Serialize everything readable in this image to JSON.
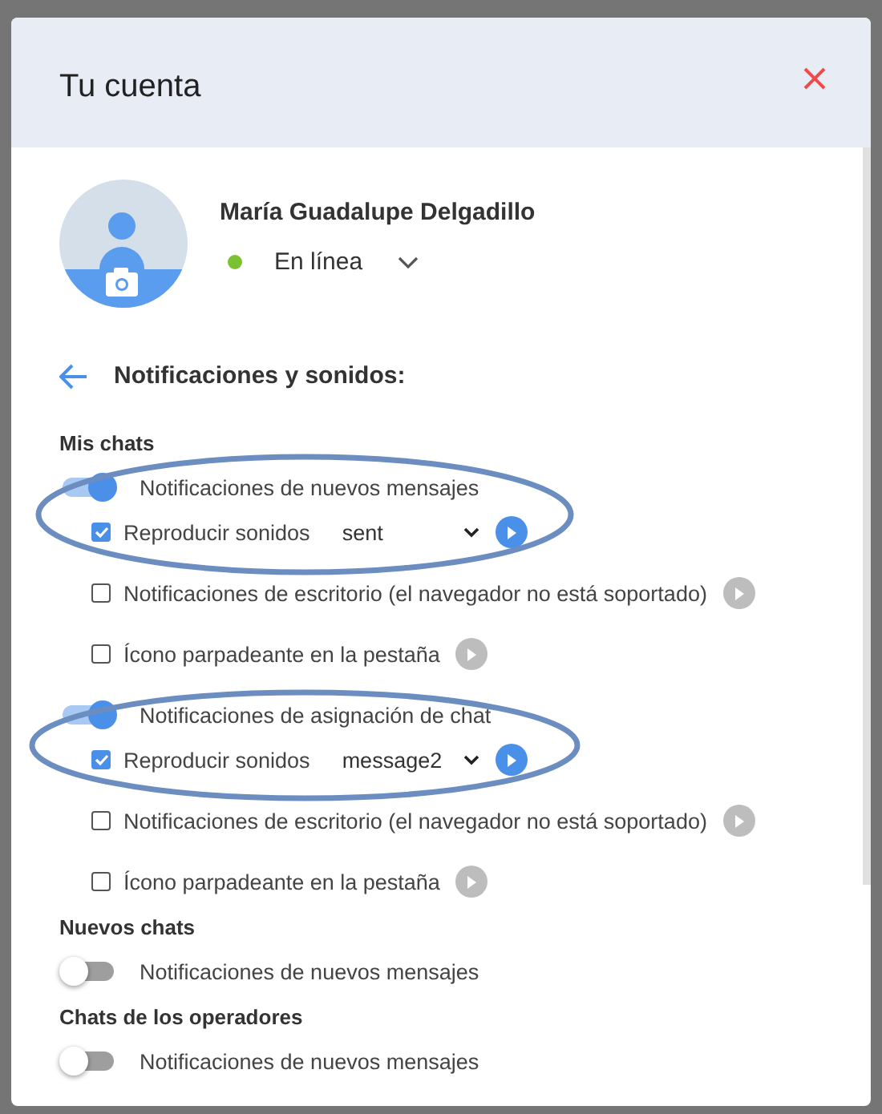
{
  "dialog": {
    "title": "Tu cuenta"
  },
  "profile": {
    "name": "María Guadalupe Delgadillo",
    "status": {
      "label": "En línea",
      "color": "#7ac231"
    }
  },
  "section_title": "Notificaciones y sonidos:",
  "groups": [
    {
      "heading": "Mis chats",
      "items": [
        {
          "kind": "toggle",
          "label": "Notificaciones de nuevos mensajes",
          "on": true
        },
        {
          "kind": "sound",
          "label": "Reproducir sonidos",
          "checked": true,
          "sound": "sent"
        },
        {
          "kind": "check",
          "label": "Notificaciones de escritorio (el navegador no está soportado)",
          "checked": false
        },
        {
          "kind": "check",
          "label": "Ícono parpadeante en la pestaña",
          "checked": false
        },
        {
          "kind": "toggle",
          "label": "Notificaciones de asignación de chat",
          "on": true
        },
        {
          "kind": "sound",
          "label": "Reproducir sonidos",
          "checked": true,
          "sound": "message2"
        },
        {
          "kind": "check",
          "label": "Notificaciones de escritorio (el navegador no está soportado)",
          "checked": false
        },
        {
          "kind": "check",
          "label": "Ícono parpadeante en la pestaña",
          "checked": false
        }
      ]
    },
    {
      "heading": "Nuevos chats",
      "items": [
        {
          "kind": "toggle",
          "label": "Notificaciones de nuevos mensajes",
          "on": false
        }
      ]
    },
    {
      "heading": "Chats de los operadores",
      "items": [
        {
          "kind": "toggle",
          "label": "Notificaciones de nuevos mensajes",
          "on": false
        }
      ]
    }
  ]
}
